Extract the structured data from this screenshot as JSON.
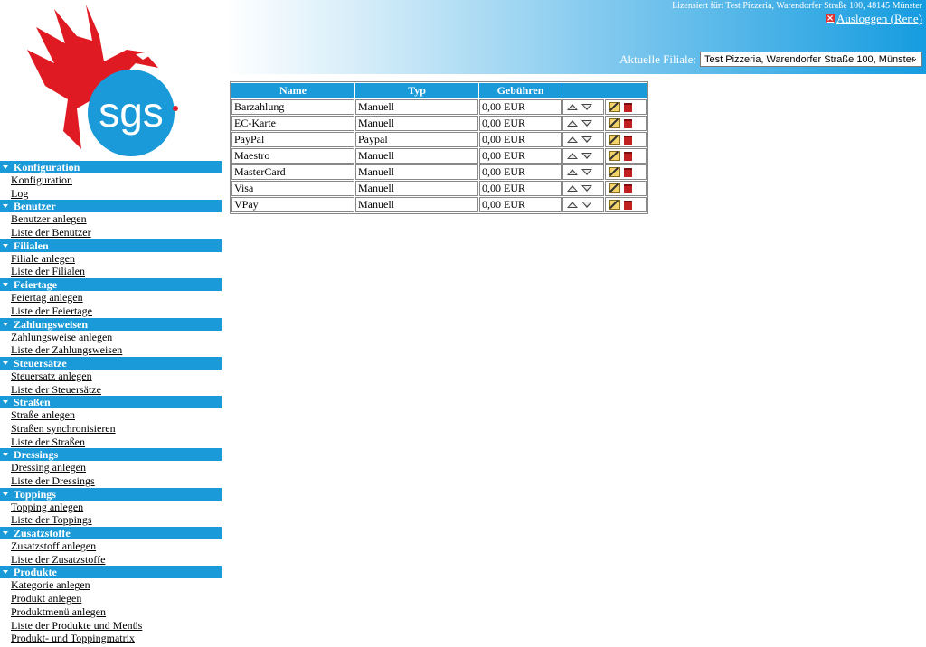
{
  "header": {
    "license": "Lizensiert für: Test Pizzeria, Warendorfer Straße 100, 48145 Münster",
    "logout": "Ausloggen (Rene)",
    "filiale_label": "Aktuelle Filiale:",
    "filiale_value": "Test Pizzeria, Warendorfer Straße 100, Münster",
    "logo_text": "sgs"
  },
  "colors": {
    "accent": "#1a9ad9",
    "logo_red": "#e01a22"
  },
  "sidebar": [
    {
      "title": "Konfiguration",
      "links": [
        "Konfiguration",
        "Log"
      ]
    },
    {
      "title": "Benutzer",
      "links": [
        "Benutzer anlegen",
        "Liste der Benutzer"
      ]
    },
    {
      "title": "Filialen",
      "links": [
        "Filiale anlegen",
        "Liste der Filialen"
      ]
    },
    {
      "title": "Feiertage",
      "links": [
        "Feiertag anlegen",
        "Liste der Feiertage"
      ]
    },
    {
      "title": "Zahlungsweisen",
      "links": [
        "Zahlungsweise anlegen",
        "Liste der Zahlungsweisen"
      ]
    },
    {
      "title": "Steuersätze",
      "links": [
        "Steuersatz anlegen",
        "Liste der Steuersätze"
      ]
    },
    {
      "title": "Straßen",
      "links": [
        "Straße anlegen",
        "Straßen synchronisieren",
        "Liste der Straßen"
      ]
    },
    {
      "title": "Dressings",
      "links": [
        "Dressing anlegen",
        "Liste der Dressings"
      ]
    },
    {
      "title": "Toppings",
      "links": [
        "Topping anlegen",
        "Liste der Toppings"
      ]
    },
    {
      "title": "Zusatzstoffe",
      "links": [
        "Zusatzstoff anlegen",
        "Liste der Zusatzstoffe"
      ]
    },
    {
      "title": "Produkte",
      "links": [
        "Kategorie anlegen",
        "Produkt anlegen",
        "Produktmenü anlegen",
        "Liste der Produkte und Menüs",
        "Produkt- und Toppingmatrix"
      ]
    }
  ],
  "table": {
    "headers": [
      "Name",
      "Typ",
      "Gebühren",
      ""
    ],
    "rows": [
      {
        "name": "Barzahlung",
        "typ": "Manuell",
        "fee": "0,00 EUR"
      },
      {
        "name": "EC-Karte",
        "typ": "Manuell",
        "fee": "0,00 EUR"
      },
      {
        "name": "PayPal",
        "typ": "Paypal",
        "fee": "0,00 EUR"
      },
      {
        "name": "Maestro",
        "typ": "Manuell",
        "fee": "0,00 EUR"
      },
      {
        "name": "MasterCard",
        "typ": "Manuell",
        "fee": "0,00 EUR"
      },
      {
        "name": "Visa",
        "typ": "Manuell",
        "fee": "0,00 EUR"
      },
      {
        "name": "VPay",
        "typ": "Manuell",
        "fee": "0,00 EUR"
      }
    ]
  }
}
